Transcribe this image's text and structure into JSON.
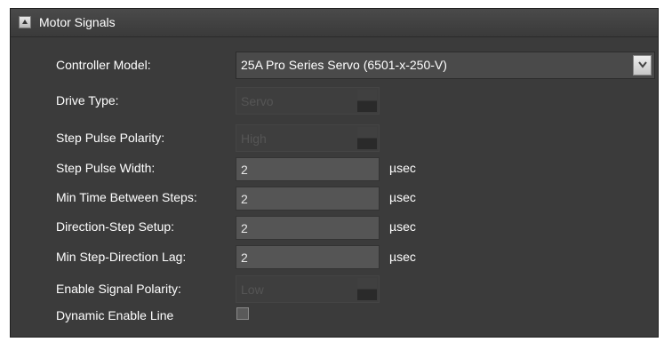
{
  "panel": {
    "title": "Motor Signals"
  },
  "fields": {
    "controller_model": {
      "label": "Controller Model:",
      "value": "25A Pro Series Servo (6501-x-250-V)"
    },
    "drive_type": {
      "label": "Drive Type:",
      "value": "Servo"
    },
    "step_pulse_polarity": {
      "label": "Step Pulse Polarity:",
      "value": "High"
    },
    "step_pulse_width": {
      "label": "Step Pulse Width:",
      "value": "2",
      "unit": "µsec"
    },
    "min_time_between_steps": {
      "label": "Min Time Between Steps:",
      "value": "2",
      "unit": "µsec"
    },
    "direction_step_setup": {
      "label": "Direction-Step Setup:",
      "value": "2",
      "unit": "µsec"
    },
    "min_step_direction_lag": {
      "label": "Min Step-Direction Lag:",
      "value": "2",
      "unit": "µsec"
    },
    "enable_signal_polarity": {
      "label": "Enable Signal Polarity:",
      "value": "Low"
    },
    "dynamic_enable_line": {
      "label": "Dynamic Enable Line"
    }
  }
}
